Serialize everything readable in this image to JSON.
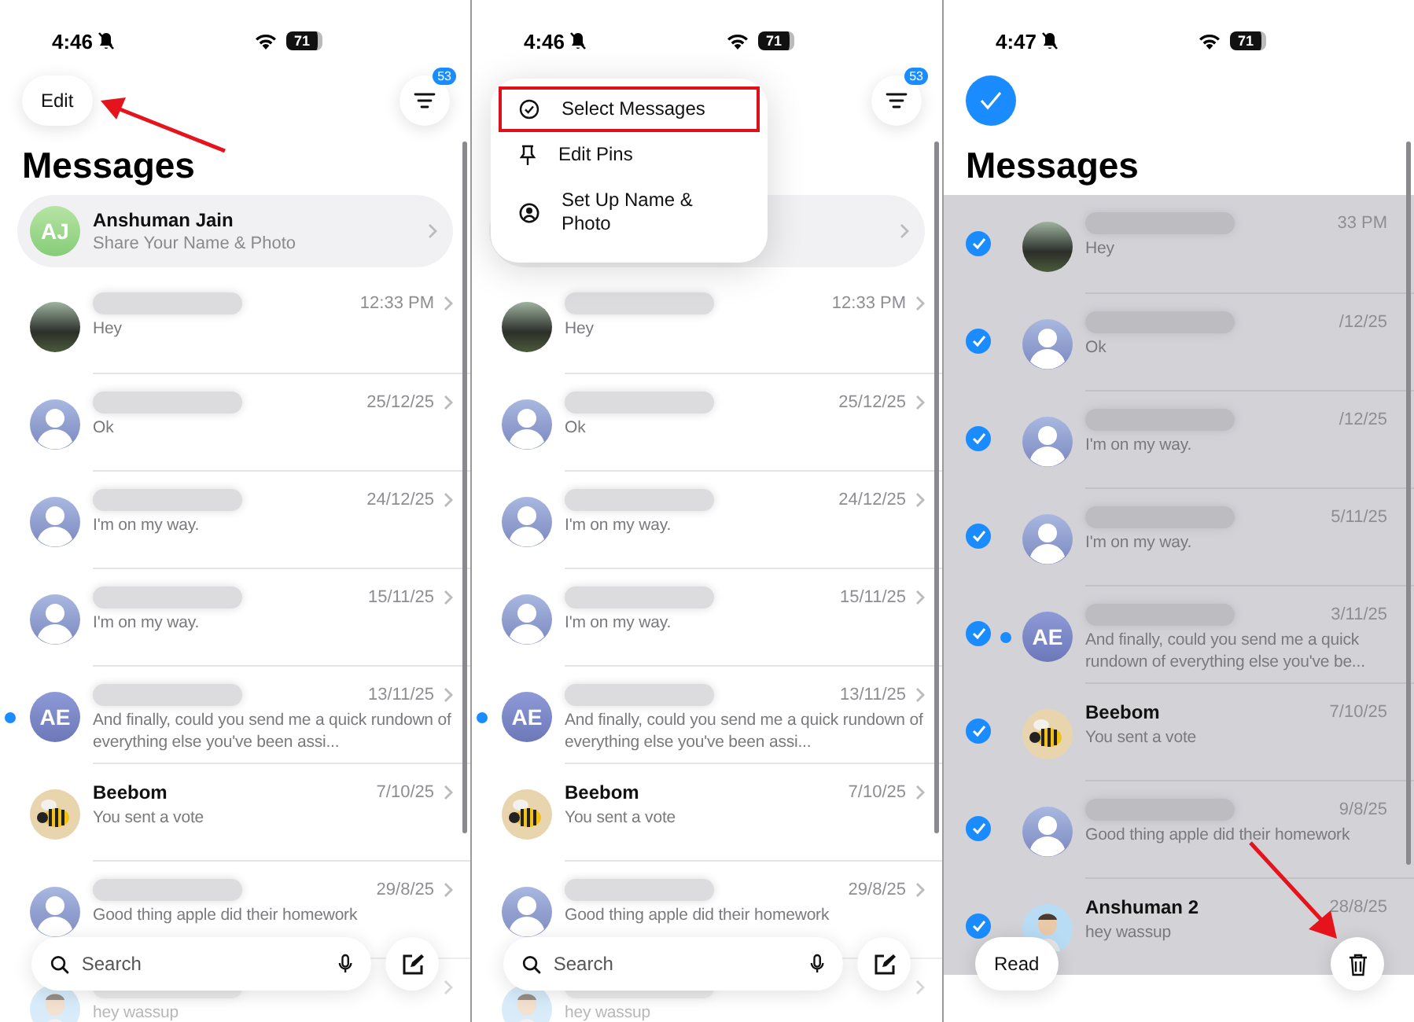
{
  "panels": [
    {
      "kind": "browse",
      "time": "4:46",
      "battery": "71",
      "edit": "Edit",
      "badge": "53",
      "title": "Messages",
      "profile": {
        "initials": "AJ",
        "name": "Anshuman Jain",
        "subtitle": "Share Your Name & Photo"
      },
      "rows": [
        {
          "kind": "photo",
          "preview": "Hey",
          "time": "12:33 PM",
          "unread": false,
          "faded": false
        },
        {
          "kind": "person",
          "preview": "Ok",
          "time": "25/12/25",
          "unread": false,
          "faded": false
        },
        {
          "kind": "person",
          "preview": "I'm on my way.",
          "time": "24/12/25",
          "unread": false,
          "faded": false
        },
        {
          "kind": "person",
          "preview": "I'm on my way.",
          "time": "15/11/25",
          "unread": false,
          "faded": false
        },
        {
          "kind": "initials",
          "initials": "AE",
          "preview": "And finally, could you send me a quick rundown of everything else you've been assi...",
          "time": "13/11/25",
          "unread": true,
          "faded": false
        },
        {
          "kind": "bee",
          "name": "Beebom",
          "preview": "You sent a vote",
          "time": "7/10/25",
          "unread": false,
          "faded": false
        },
        {
          "kind": "person",
          "preview": "Good thing apple did their homework",
          "time": "29/8/25",
          "unread": false,
          "faded": false
        },
        {
          "kind": "memoji",
          "preview": "hey wassup",
          "unread": false,
          "faded": true
        }
      ],
      "search": {
        "placeholder": "Search"
      }
    },
    {
      "kind": "menu",
      "time": "4:46",
      "battery": "71",
      "badge": "53",
      "menu": [
        {
          "kind": "check",
          "label": "Select Messages",
          "highlighted": true
        },
        {
          "kind": "pin",
          "label": "Edit Pins",
          "highlighted": false
        },
        {
          "kind": "person",
          "label": "Set Up Name & Photo",
          "highlighted": false
        }
      ],
      "rows": [
        {
          "kind": "photo",
          "preview": "Hey",
          "time": "12:33 PM",
          "unread": false,
          "faded": false
        },
        {
          "kind": "person",
          "preview": "Ok",
          "time": "25/12/25",
          "unread": false,
          "faded": false
        },
        {
          "kind": "person",
          "preview": "I'm on my way.",
          "time": "24/12/25",
          "unread": false,
          "faded": false
        },
        {
          "kind": "person",
          "preview": "I'm on my way.",
          "time": "15/11/25",
          "unread": false,
          "faded": false
        },
        {
          "kind": "initials",
          "initials": "AE",
          "preview": "And finally, could you send me a quick rundown of everything else you've been assi...",
          "time": "13/11/25",
          "unread": true,
          "faded": false
        },
        {
          "kind": "bee",
          "name": "Beebom",
          "preview": "You sent a vote",
          "time": "7/10/25",
          "unread": false,
          "faded": false
        },
        {
          "kind": "person",
          "preview": "Good thing apple did their homework",
          "time": "29/8/25",
          "unread": false,
          "faded": false
        },
        {
          "kind": "memoji",
          "preview": "hey wassup",
          "unread": false,
          "faded": true
        }
      ],
      "search": {
        "placeholder": "Search"
      }
    },
    {
      "kind": "select",
      "time": "4:47",
      "battery": "71",
      "title": "Messages",
      "rows": [
        {
          "kind": "photo",
          "preview": "Hey",
          "time": "33 PM",
          "unread": false,
          "selected": true,
          "faded": false
        },
        {
          "kind": "person",
          "preview": "Ok",
          "time": "/12/25",
          "unread": false,
          "selected": true,
          "faded": false
        },
        {
          "kind": "person",
          "preview": "I'm on my way.",
          "time": "/12/25",
          "unread": false,
          "selected": true,
          "faded": false
        },
        {
          "kind": "person",
          "preview": "I'm on my way.",
          "time": "5/11/25",
          "unread": false,
          "selected": true,
          "faded": false
        },
        {
          "kind": "initials",
          "initials": "AE",
          "preview": "And finally, could you send me a quick rundown of everything else you've be...",
          "time": "3/11/25",
          "unread": true,
          "selected": true,
          "faded": false
        },
        {
          "kind": "bee",
          "name": "Beebom",
          "preview": "You sent a vote",
          "time": "7/10/25",
          "unread": false,
          "selected": true,
          "faded": false
        },
        {
          "kind": "person",
          "preview": "Good thing apple did their homework",
          "time": "9/8/25",
          "unread": false,
          "selected": true,
          "faded": false
        },
        {
          "kind": "memoji",
          "name": "Anshuman 2",
          "preview": "hey wassup",
          "time": "28/8/25",
          "unread": false,
          "selected": true,
          "faded": false
        }
      ],
      "actions": {
        "read": "Read"
      }
    }
  ]
}
